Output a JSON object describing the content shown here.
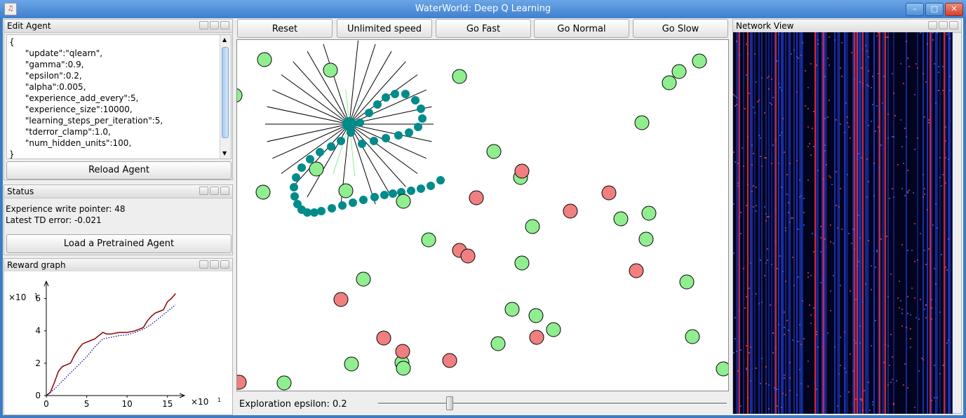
{
  "window": {
    "title": "WaterWorld: Deep Q Learning",
    "min_glyph": "–",
    "max_glyph": "□",
    "close_glyph": "✕"
  },
  "edit_agent": {
    "title": "Edit Agent",
    "code": "{\n      \"update\":\"qlearn\",\n      \"gamma\":0.9,\n      \"epsilon\":0.2,\n      \"alpha\":0.005,\n      \"experience_add_every\":5,\n      \"experience_size\":10000,\n      \"learning_steps_per_iteration\":5,\n      \"tderror_clamp\":1.0,\n      \"num_hidden_units\":100,\n}",
    "reload_label": "Reload Agent"
  },
  "status": {
    "title": "Status",
    "write_pointer": "Experience write pointer: 48",
    "td_error": "Latest TD error: -0.021",
    "load_label": "Load a Pretrained Agent"
  },
  "reward_graph": {
    "title": "Reward graph",
    "y_exp_label": "×10",
    "y_exp": "1",
    "x_exp_label": "×10",
    "x_exp": "1",
    "x_ticks": [
      "0",
      "5",
      "10",
      "15"
    ],
    "y_ticks": [
      "0",
      "2",
      "4",
      "6"
    ]
  },
  "chart_data": {
    "type": "line",
    "xlim": [
      0,
      16.5
    ],
    "ylim": [
      0,
      6.5
    ],
    "x_tick_values": [
      0,
      5,
      10,
      15
    ],
    "y_tick_values": [
      0,
      2,
      4,
      6
    ],
    "series": [
      {
        "style": "solid",
        "color": "#8b0000",
        "x": [
          0,
          0.5,
          1,
          1.5,
          2,
          2.5,
          3,
          3.5,
          4,
          4.5,
          5,
          5.5,
          6,
          6.5,
          7,
          7.5,
          8,
          9,
          10,
          11,
          12,
          12.5,
          13,
          13.5,
          14,
          14.5,
          15,
          15.5,
          16
        ],
        "y": [
          0,
          0.2,
          0.8,
          1.5,
          1.8,
          1.9,
          2.0,
          2.5,
          2.9,
          3.2,
          3.3,
          3.4,
          3.5,
          3.7,
          3.9,
          3.8,
          3.8,
          3.9,
          3.9,
          4.0,
          4.2,
          4.6,
          4.9,
          5.1,
          5.2,
          5.3,
          5.8,
          6.0,
          6.3
        ]
      },
      {
        "style": "dotted",
        "color": "#00008b",
        "x": [
          0,
          1,
          2,
          3,
          4,
          5,
          6,
          7,
          8,
          9,
          10,
          11,
          12,
          13,
          14,
          15,
          16
        ],
        "y": [
          0,
          0.4,
          0.9,
          1.4,
          1.9,
          2.4,
          3.0,
          3.5,
          3.6,
          3.7,
          3.75,
          3.9,
          4.1,
          4.4,
          4.8,
          5.2,
          5.6
        ]
      }
    ]
  },
  "controls": {
    "reset": "Reset",
    "unlimited": "Unlimited speed",
    "fast": "Go Fast",
    "normal": "Go Normal",
    "slow": "Go Slow"
  },
  "exploration": {
    "label": "Exploration epsilon: 0.2",
    "value": 0.2,
    "max": 1.0
  },
  "network_view": {
    "title": "Network View"
  },
  "colors": {
    "good_item": "#90ee90",
    "bad_item": "#f08080",
    "agent": "#008b8b"
  }
}
